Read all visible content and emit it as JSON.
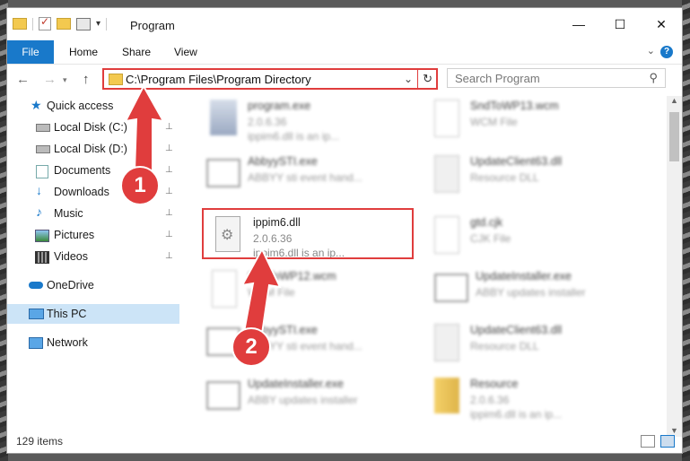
{
  "window": {
    "title": "Program",
    "minimize_glyph": "—",
    "maximize_glyph": "☐",
    "close_glyph": "✕"
  },
  "ribbon": {
    "tabs": [
      "File",
      "Home",
      "Share",
      "View"
    ],
    "help_glyph": "?",
    "collapse_glyph": "⌄"
  },
  "nav": {
    "back_glyph": "←",
    "forward_glyph": "→",
    "up_glyph": "↑",
    "address": "C:\\Program Files\\Program Directory",
    "address_chevron": "⌄",
    "refresh_glyph": "↻",
    "search_placeholder": "Search Program",
    "search_glyph": "⚲"
  },
  "sidebar": {
    "items": [
      {
        "label": "Quick access",
        "icon": "star-icon"
      },
      {
        "label": "Local Disk (C:)",
        "icon": "drive-icon",
        "pinned": true
      },
      {
        "label": "Local Disk (D:)",
        "icon": "drive-icon",
        "pinned": true
      },
      {
        "label": "Documents",
        "icon": "documents-icon",
        "pinned": true
      },
      {
        "label": "Downloads",
        "icon": "download-icon",
        "pinned": true
      },
      {
        "label": "Music",
        "icon": "music-icon",
        "pinned": true
      },
      {
        "label": "Pictures",
        "icon": "pictures-icon",
        "pinned": true
      },
      {
        "label": "Videos",
        "icon": "videos-icon",
        "pinned": true
      },
      {
        "label": "OneDrive",
        "icon": "cloud-icon"
      },
      {
        "label": "This PC",
        "icon": "computer-icon",
        "selected": true
      },
      {
        "label": "Network",
        "icon": "network-icon"
      }
    ],
    "pin_glyph": "📌"
  },
  "files": [
    {
      "name": "program.exe",
      "line2": "2.0.6.36",
      "line3": "ippim6.dll is an ip...",
      "icon": "exe-icon"
    },
    {
      "name": "SndToWP13.wcm",
      "line2": "WCM File",
      "line3": "",
      "icon": "blank-file-icon"
    },
    {
      "name": "AbbyySTI.exe",
      "line2": "ABBYY sti event hand...",
      "line3": "",
      "icon": "window-app-icon"
    },
    {
      "name": "UpdateClient63.dll",
      "line2": "Resource DLL",
      "line3": "",
      "icon": "dll-icon"
    },
    {
      "name": "ippim6.dll",
      "line2": "2.0.6.36",
      "line3": "ippim6.dll is an ip...",
      "icon": "dll-gear-icon"
    },
    {
      "name": "gtd.cjk",
      "line2": "CJK File",
      "line3": "",
      "icon": "blank-file-icon"
    },
    {
      "name": "SndToWP12.wcm",
      "line2": "WCM File",
      "line3": "",
      "icon": "blank-file-icon"
    },
    {
      "name": "UpdateInstaller.exe",
      "line2": "ABBY updates installer",
      "line3": "",
      "icon": "window-app-icon"
    },
    {
      "name": "AbbyySTI.exe",
      "line2": "ABBYY sti event hand...",
      "line3": "",
      "icon": "window-app-icon"
    },
    {
      "name": "UpdateClient63.dll",
      "line2": "Resource DLL",
      "line3": "",
      "icon": "dll-icon"
    },
    {
      "name": "UpdateInstaller.exe",
      "line2": "ABBY updates installer",
      "line3": "",
      "icon": "window-app-icon"
    },
    {
      "name": "Resource",
      "line2": "2.0.6.36",
      "line3": "ippim6.dll is an ip...",
      "icon": "archive-icon"
    }
  ],
  "status": {
    "items_count": "129 items"
  },
  "annotations": {
    "step1": "1",
    "step2": "2"
  },
  "colors": {
    "accent": "#1979ca",
    "highlight": "#e03d3d",
    "selection": "#cce4f7"
  }
}
